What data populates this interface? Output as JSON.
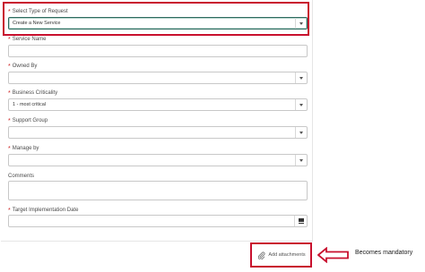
{
  "form": {
    "request_type": {
      "label": "Select Type of Request",
      "value": "Create a New Service",
      "required": true
    },
    "service_name": {
      "label": "Service Name",
      "value": "",
      "required": true
    },
    "owned_by": {
      "label": "Owned By",
      "value": "",
      "required": true
    },
    "business_criticality": {
      "label": "Business Criticality",
      "value": "1 - most critical",
      "required": true
    },
    "support_group": {
      "label": "Support Group",
      "value": "",
      "required": true
    },
    "manage_by": {
      "label": "Manage by",
      "value": "",
      "required": true
    },
    "comments": {
      "label": "Comments",
      "value": "",
      "required": false
    },
    "target_date": {
      "label": "Target Implementation Date",
      "value": "",
      "required": true
    }
  },
  "attachments": {
    "label": "Add attachments"
  },
  "annotation": {
    "text": "Becomes mandatory",
    "color": "#c8102e"
  },
  "colors": {
    "required_asterisk": "#cc1f1f",
    "focus_border": "#2d6a5e",
    "highlight_box": "#c8102e"
  },
  "icons": [
    "chevron-down-icon",
    "calendar-icon",
    "paperclip-icon",
    "arrow-left-icon"
  ]
}
